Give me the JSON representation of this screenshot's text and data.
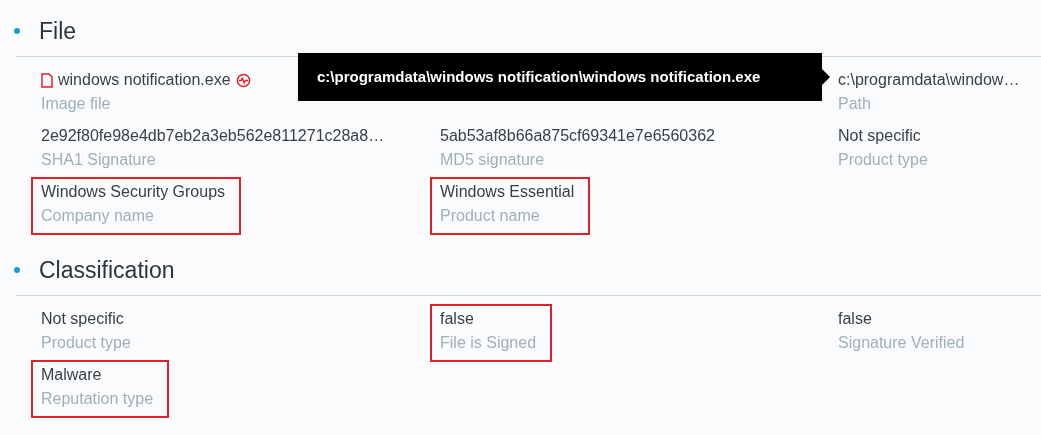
{
  "sections": [
    {
      "title": "File",
      "fields": [
        {
          "kind": "file",
          "value": "windows notification.exe",
          "label": "Image file",
          "highlighted": false
        },
        {
          "kind": "covered"
        },
        {
          "kind": "plain",
          "value": "c:\\programdata\\window…",
          "label": "Path",
          "highlighted": false
        },
        {
          "kind": "plain",
          "value": "2e92f80fe98e4db7eb2a3eb562e811271c28a8…",
          "label": "SHA1 Signature",
          "highlighted": false
        },
        {
          "kind": "plain",
          "value": "5ab53af8b66a875cf69341e7e6560362",
          "label": "MD5 signature",
          "highlighted": false
        },
        {
          "kind": "plain",
          "value": "Not specific",
          "label": "Product type",
          "highlighted": false
        },
        {
          "kind": "plain",
          "value": "Windows Security Groups",
          "label": "Company name",
          "highlighted": true
        },
        {
          "kind": "plain",
          "value": "Windows Essential",
          "label": "Product name",
          "highlighted": true
        }
      ]
    },
    {
      "title": "Classification",
      "fields": [
        {
          "kind": "plain",
          "value": "Not specific",
          "label": "Product type",
          "highlighted": false
        },
        {
          "kind": "plain",
          "value": "false",
          "label": "File is Signed",
          "highlighted": true
        },
        {
          "kind": "plain",
          "value": "false",
          "label": "Signature Verified",
          "highlighted": false
        },
        {
          "kind": "plain",
          "value": "Malware",
          "label": "Reputation type",
          "highlighted": true
        }
      ]
    }
  ],
  "tooltip": {
    "text": "c:\\programdata\\windows notification\\windows notification.exe"
  }
}
